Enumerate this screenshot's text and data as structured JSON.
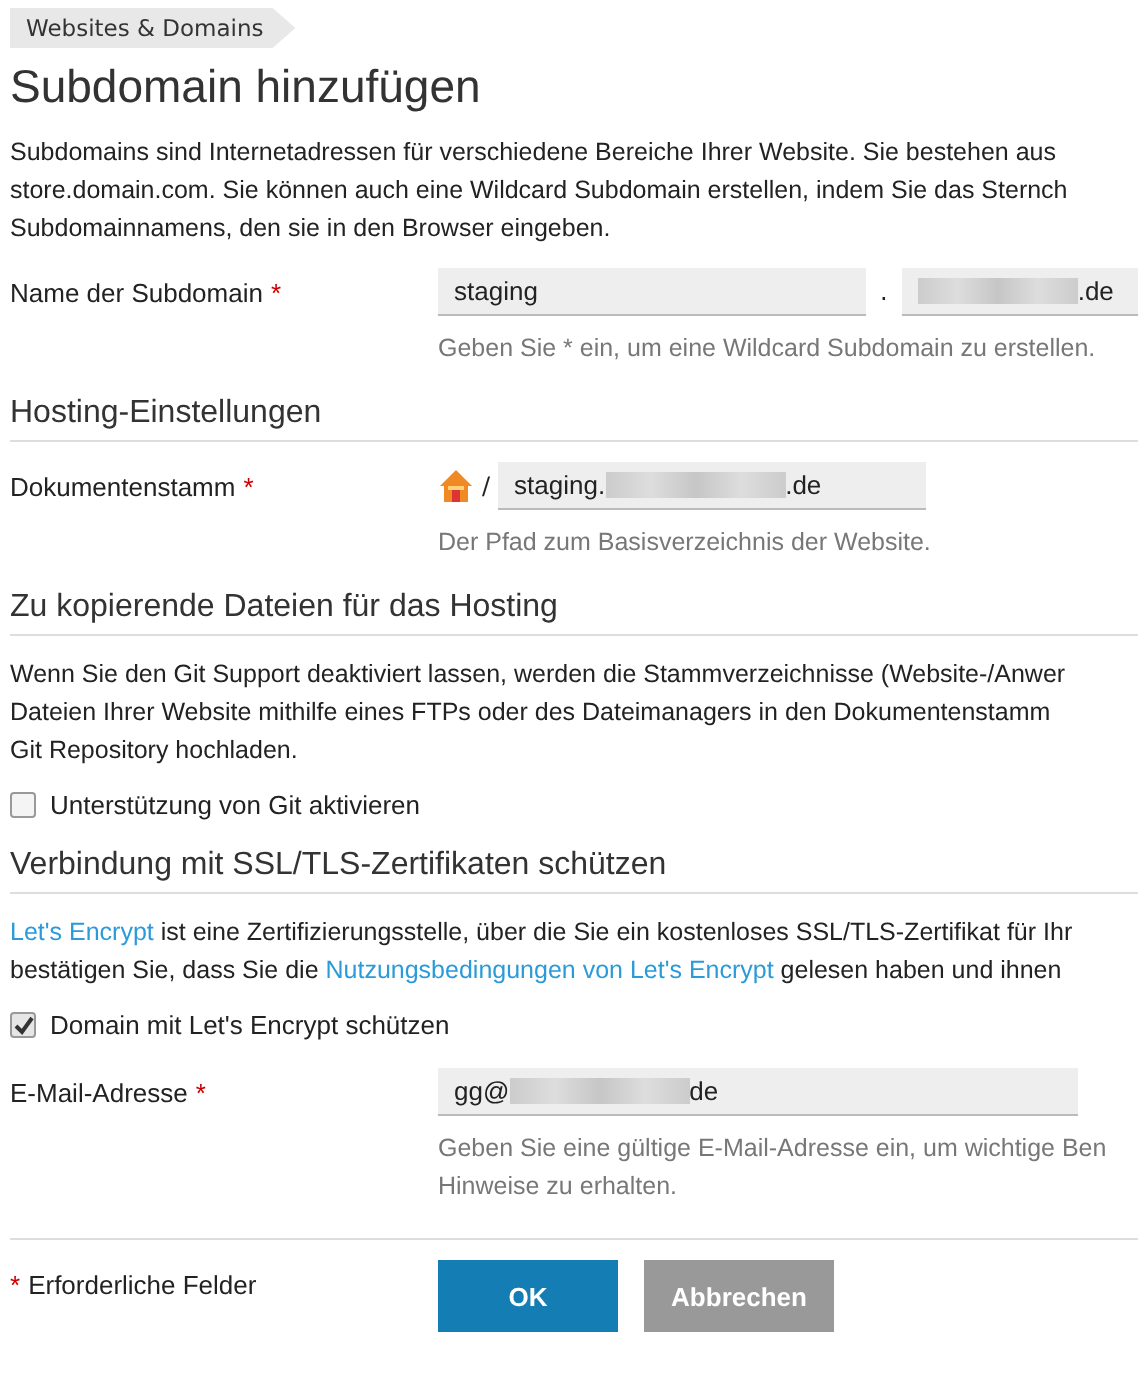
{
  "breadcrumb": "Websites & Domains",
  "title": "Subdomain hinzufügen",
  "intro": [
    "Subdomains sind Internetadressen für verschiedene Bereiche Ihrer Website. Sie bestehen aus",
    "store.domain.com. Sie können auch eine Wildcard Subdomain erstellen, indem Sie das Sternch",
    "Subdomainnamens, den sie in den Browser eingeben."
  ],
  "subdomain": {
    "label": "Name der Subdomain",
    "required": true,
    "value": "staging",
    "separator": ".",
    "domain_end": ".de",
    "domain_redacted": true,
    "hint": "Geben Sie * ein, um eine Wildcard Subdomain zu erstellen."
  },
  "hosting": {
    "heading": "Hosting-Einstellungen",
    "label": "Dokumentenstamm",
    "required": true,
    "slash": "/",
    "value_start": "staging.",
    "value_redacted": true,
    "value_end": ".de",
    "hint": "Der Pfad zum Basisverzeichnis der Website."
  },
  "files": {
    "heading": "Zu kopierende Dateien für das Hosting",
    "text": [
      "Wenn Sie den Git Support deaktiviert lassen, werden die Stammverzeichnisse (Website-/Anwer",
      "Dateien Ihrer Website mithilfe eines FTPs oder des Dateimanagers in den Dokumentenstamm",
      "Git Repository hochladen."
    ],
    "checkbox": {
      "label": "Unterstützung von Git aktivieren",
      "checked": false
    }
  },
  "ssl": {
    "heading": "Verbindung mit SSL/TLS-Zertifikaten schützen",
    "line1": [
      {
        "kind": "link",
        "text": "Let's Encrypt"
      },
      {
        "kind": "text",
        "text": " ist eine Zertifizierungsstelle, über die Sie ein kostenloses SSL/TLS-Zertifikat für Ihr"
      }
    ],
    "line2": [
      {
        "kind": "text",
        "text": "bestätigen Sie, dass Sie die "
      },
      {
        "kind": "link",
        "text": "Nutzungsbedingungen von Let's Encrypt"
      },
      {
        "kind": "text",
        "text": " gelesen haben und ihnen"
      }
    ],
    "checkbox": {
      "label": "Domain mit Let's Encrypt schützen",
      "checked": true
    },
    "email": {
      "label": "E-Mail-Adresse",
      "required": true,
      "value_start": "gg@",
      "value_redacted": true,
      "value_end": "de",
      "hint": [
        "Geben Sie eine gültige E-Mail-Adresse ein, um wichtige Ben",
        "Hinweise zu erhalten."
      ]
    }
  },
  "footer": {
    "required_mark": "*",
    "required_note": "Erforderliche Felder",
    "buttons": [
      {
        "kind": "primary",
        "label": "OK"
      },
      {
        "kind": "secondary",
        "label": "Abbrechen"
      }
    ]
  }
}
